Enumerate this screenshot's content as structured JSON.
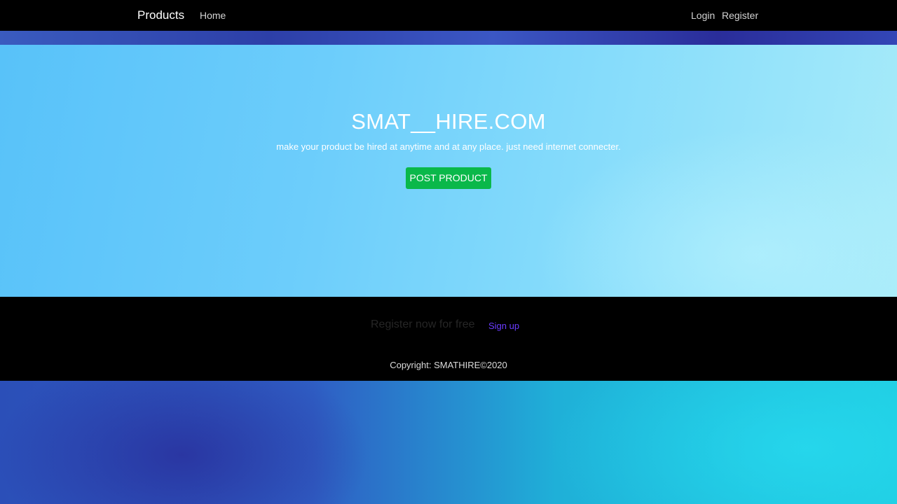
{
  "navbar": {
    "brand": "Products",
    "home": "Home",
    "login": "Login",
    "register": "Register"
  },
  "hero": {
    "title": "SMAT__HIRE.COM",
    "subtitle": "make your product be hired at anytime and at any place. just need internet connecter.",
    "button_label": "POST PRODUCT"
  },
  "footer": {
    "cta_text": "Register now for free",
    "signup_link": "Sign up",
    "copyright": "Copyright: SMATHIRE©2020"
  },
  "colors": {
    "navbar_bg": "#000000",
    "hero_start": "#58c2f9",
    "hero_end": "#a7ebf9",
    "button_green": "#0ab84a",
    "signup_link": "#6a3cff",
    "footer_bg": "#000000"
  }
}
